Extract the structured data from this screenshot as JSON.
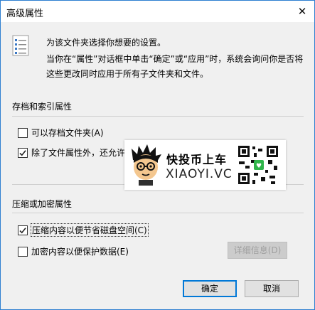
{
  "window": {
    "title": "高级属性",
    "close_glyph": "✕"
  },
  "description": {
    "line1": "为该文件夹选择你想要的设置。",
    "line2": "当你在“属性”对话框中单击“确定”或“应用”时，系统会询问你是否将这些更改同时应用于所有子文件夹和文件。"
  },
  "archive_group": {
    "title": "存档和索引属性",
    "archive_checkbox": {
      "label": "可以存档文件夹(A)",
      "checked": false
    },
    "index_checkbox": {
      "label": "除了文件属性外，还允许",
      "checked": true
    }
  },
  "compress_group": {
    "title": "压缩或加密属性",
    "compress_checkbox": {
      "label": "压缩内容以便节省磁盘空间(C)",
      "checked": true
    },
    "encrypt_checkbox": {
      "label": "加密内容以便保护数据(E)",
      "checked": false
    },
    "details_button": "详细信息(D)"
  },
  "buttons": {
    "ok": "确定",
    "cancel": "取消"
  },
  "watermark": {
    "name": "快投币上车",
    "domain": "XIAOYI.VC"
  },
  "colors": {
    "accent": "#0078d7",
    "window_border": "#2d7fd1",
    "background": "#f0f0f0"
  }
}
